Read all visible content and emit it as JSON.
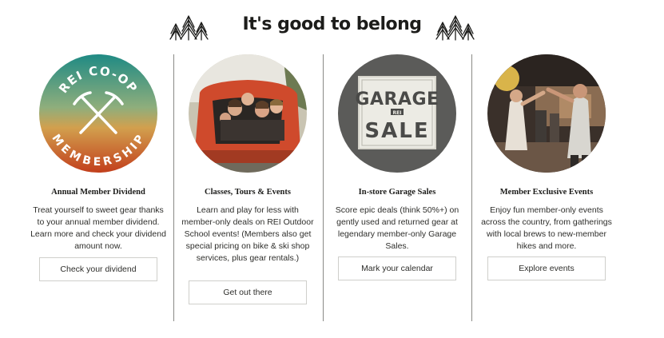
{
  "header": {
    "title": "It's good to belong"
  },
  "columns": [
    {
      "title": "Annual Member Dividend",
      "body": "Treat yourself to sweet gear thanks to your annual member dividend. Learn more and check your dividend amount now.",
      "button": "Check your dividend",
      "image": {
        "top_text": "REI CO-OP",
        "bottom_text": "MEMBERSHIP",
        "colors": {
          "top": "#2f8c80",
          "middle": "#c7a04a",
          "bottom": "#c8451c"
        }
      }
    },
    {
      "title": "Classes, Tours & Events",
      "body": "Learn and play for less with member-only deals on REI Outdoor School events! (Members also get special pricing on bike & ski shop services, plus gear rentals.)",
      "button": "Get out there"
    },
    {
      "title": "In-store Garage Sales",
      "body": "Score epic deals (think 50%+) on gently used and returned gear at legendary member-only Garage Sales.",
      "button": "Mark your calendar",
      "image": {
        "line1": "GARAGE",
        "line2": "SALE",
        "logo": "REI"
      }
    },
    {
      "title": "Member Exclusive Events",
      "body": "Enjoy fun member-only events across the country, from gatherings with local brews to new-member hikes and more.",
      "button": "Explore events"
    }
  ]
}
